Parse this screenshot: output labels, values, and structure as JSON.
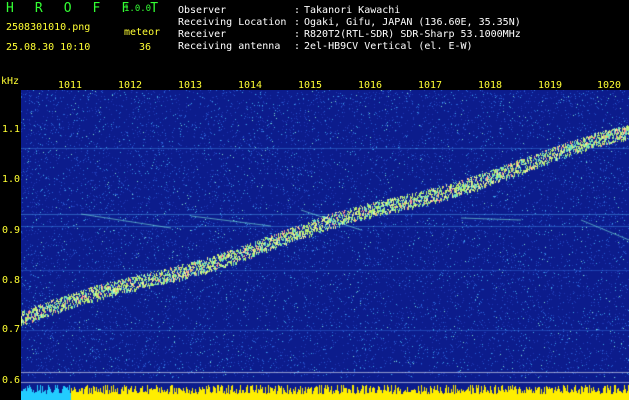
{
  "header": {
    "app_title": "H R O F F T",
    "version": "1.0.0",
    "filename": "2508301010.png",
    "mode_label": "meteor",
    "timestamp": "25.08.30 10:10",
    "count": "36"
  },
  "station_info": [
    {
      "key": "Observer",
      "value": "Takanori Kawachi"
    },
    {
      "key": "Receiving Location",
      "value": "Ogaki, Gifu, JAPAN (136.60E, 35.35N)"
    },
    {
      "key": "Receiver",
      "value": "R820T2(RTL-SDR) SDR-Sharp 53.1000MHz"
    },
    {
      "key": "Receiving antenna",
      "value": "2el-HB9CV Vertical (el. E-W)"
    }
  ],
  "axes": {
    "y_unit": "kHz",
    "x_ticks": [
      "1011",
      "1012",
      "1013",
      "1014",
      "1015",
      "1016",
      "1017",
      "1018",
      "1019",
      "1020"
    ],
    "y_ticks": [
      "1.1",
      "1.0",
      "0.9",
      "0.8",
      "0.7",
      "0.6"
    ]
  },
  "colors": {
    "background": "#0c1c8c",
    "header_green": "#33ff33",
    "header_yellow": "#ffff33",
    "tick_yellow": "#ffff33",
    "bottom_bar_cyan": "#22ccff",
    "bottom_bar_yellow": "#ffee00"
  }
}
